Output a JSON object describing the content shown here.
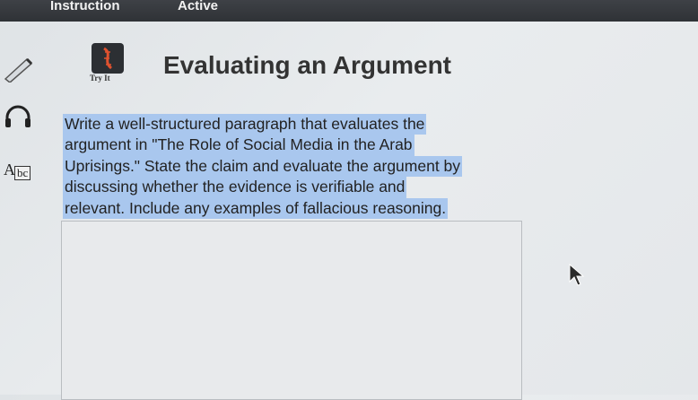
{
  "top_bar": {
    "tab_instruction": "Instruction",
    "tab_active": "Active"
  },
  "tools": {
    "pencil": "pencil-icon",
    "headphones": "headphones-icon",
    "abc": {
      "a": "A",
      "bc": "bc"
    }
  },
  "try_it": {
    "label": "Try It",
    "icon": "dna-icon"
  },
  "title": "Evaluating an Argument",
  "prompt_lines": [
    "Write a well-structured paragraph that evaluates the",
    "argument in \"The Role of Social Media in the Arab",
    "Uprisings.\" State the claim and evaluate the argument by",
    "discussing whether the evidence is verifiable and",
    "relevant. Include any examples of fallacious reasoning."
  ],
  "answer_box": {
    "value": ""
  },
  "colors": {
    "highlight": "#a9c7ee",
    "accent": "#e0522f",
    "topbar": "#3a3d41"
  }
}
